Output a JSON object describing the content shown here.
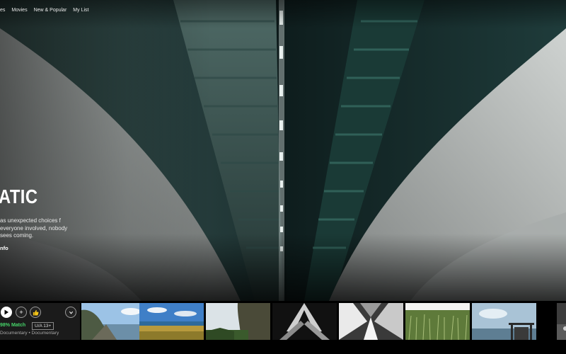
{
  "nav": {
    "items": [
      "es",
      "Movies",
      "New & Popular",
      "My List"
    ]
  },
  "hero": {
    "title": "ATIC",
    "description": "as unexpected choices f everyone involved, nobody sees coming.",
    "info_label": "nfo"
  },
  "featured": {
    "match": "98% Match",
    "rating": "U/A 13+",
    "genres": "Documentary • Documentary",
    "icons": [
      "play-icon",
      "plus-icon",
      "thumbs-up-icon",
      "chevron-down-icon"
    ]
  },
  "thumbnails": [
    "coastal-rock-landscape",
    "meadow-sunset",
    "forest-cliff",
    "dark-architecture",
    "skyscraper-upward",
    "wheat-field",
    "sea-pier-sky",
    "partial-thumbnail"
  ]
}
